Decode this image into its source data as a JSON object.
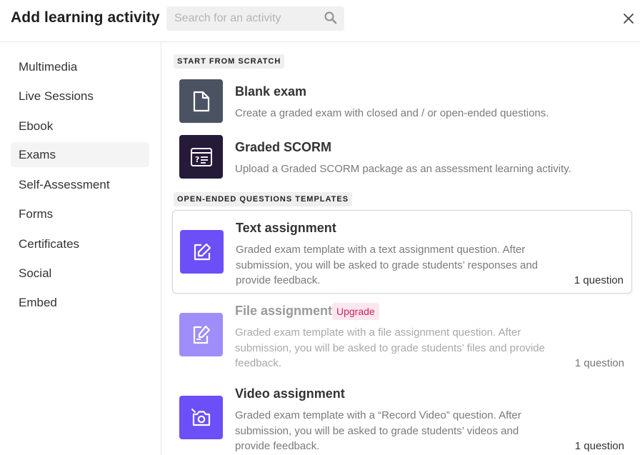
{
  "header": {
    "title": "Add learning activity",
    "search_placeholder": "Search for an activity",
    "search_value": ""
  },
  "icons": {
    "search": "search-icon",
    "close": "close-icon"
  },
  "sidebar": {
    "active": "Exams",
    "items": [
      {
        "label": "Multimedia"
      },
      {
        "label": "Live Sessions"
      },
      {
        "label": "Ebook"
      },
      {
        "label": "Exams"
      },
      {
        "label": "Self-Assessment"
      },
      {
        "label": "Forms"
      },
      {
        "label": "Certificates"
      },
      {
        "label": "Social"
      },
      {
        "label": "Embed"
      }
    ]
  },
  "main": {
    "sections": [
      {
        "label": "START FROM SCRATCH"
      },
      {
        "label": "OPEN-ENDED QUESTIONS TEMPLATES"
      }
    ],
    "activities": [
      {
        "title": "Blank exam",
        "description": "Create a graded exam with closed and / or open-ended questions.",
        "icon": "blank-document-icon",
        "icon_color": "#4b5363"
      },
      {
        "title": "Graded SCORM",
        "description": "Upload a Graded SCORM package as an assessment learning activity.",
        "icon": "scorm-package-icon",
        "icon_color": "#261a39"
      },
      {
        "title": "Text assignment",
        "description": "Graded exam template with a text assignment question. After submission, you will be asked to grade students’ responses and provide feedback.",
        "count": "1 question",
        "icon": "edit-note-icon",
        "icon_color": "#6c4ff6"
      },
      {
        "title": "File assignment",
        "badge": "Upgrade",
        "description": "Graded exam template with a file assignment question. After submission, you will be asked to grade students’ files and provide feedback.",
        "count": "1 question",
        "icon": "file-edit-icon",
        "icon_color": "#9f8dfa"
      },
      {
        "title": "Video assignment",
        "description": "Graded exam template with a “Record Video” question. After submission, you will be asked to grade students’ videos and provide feedback.",
        "count": "1 question",
        "icon": "video-camera-icon",
        "icon_color": "#6c4ff6"
      }
    ]
  }
}
